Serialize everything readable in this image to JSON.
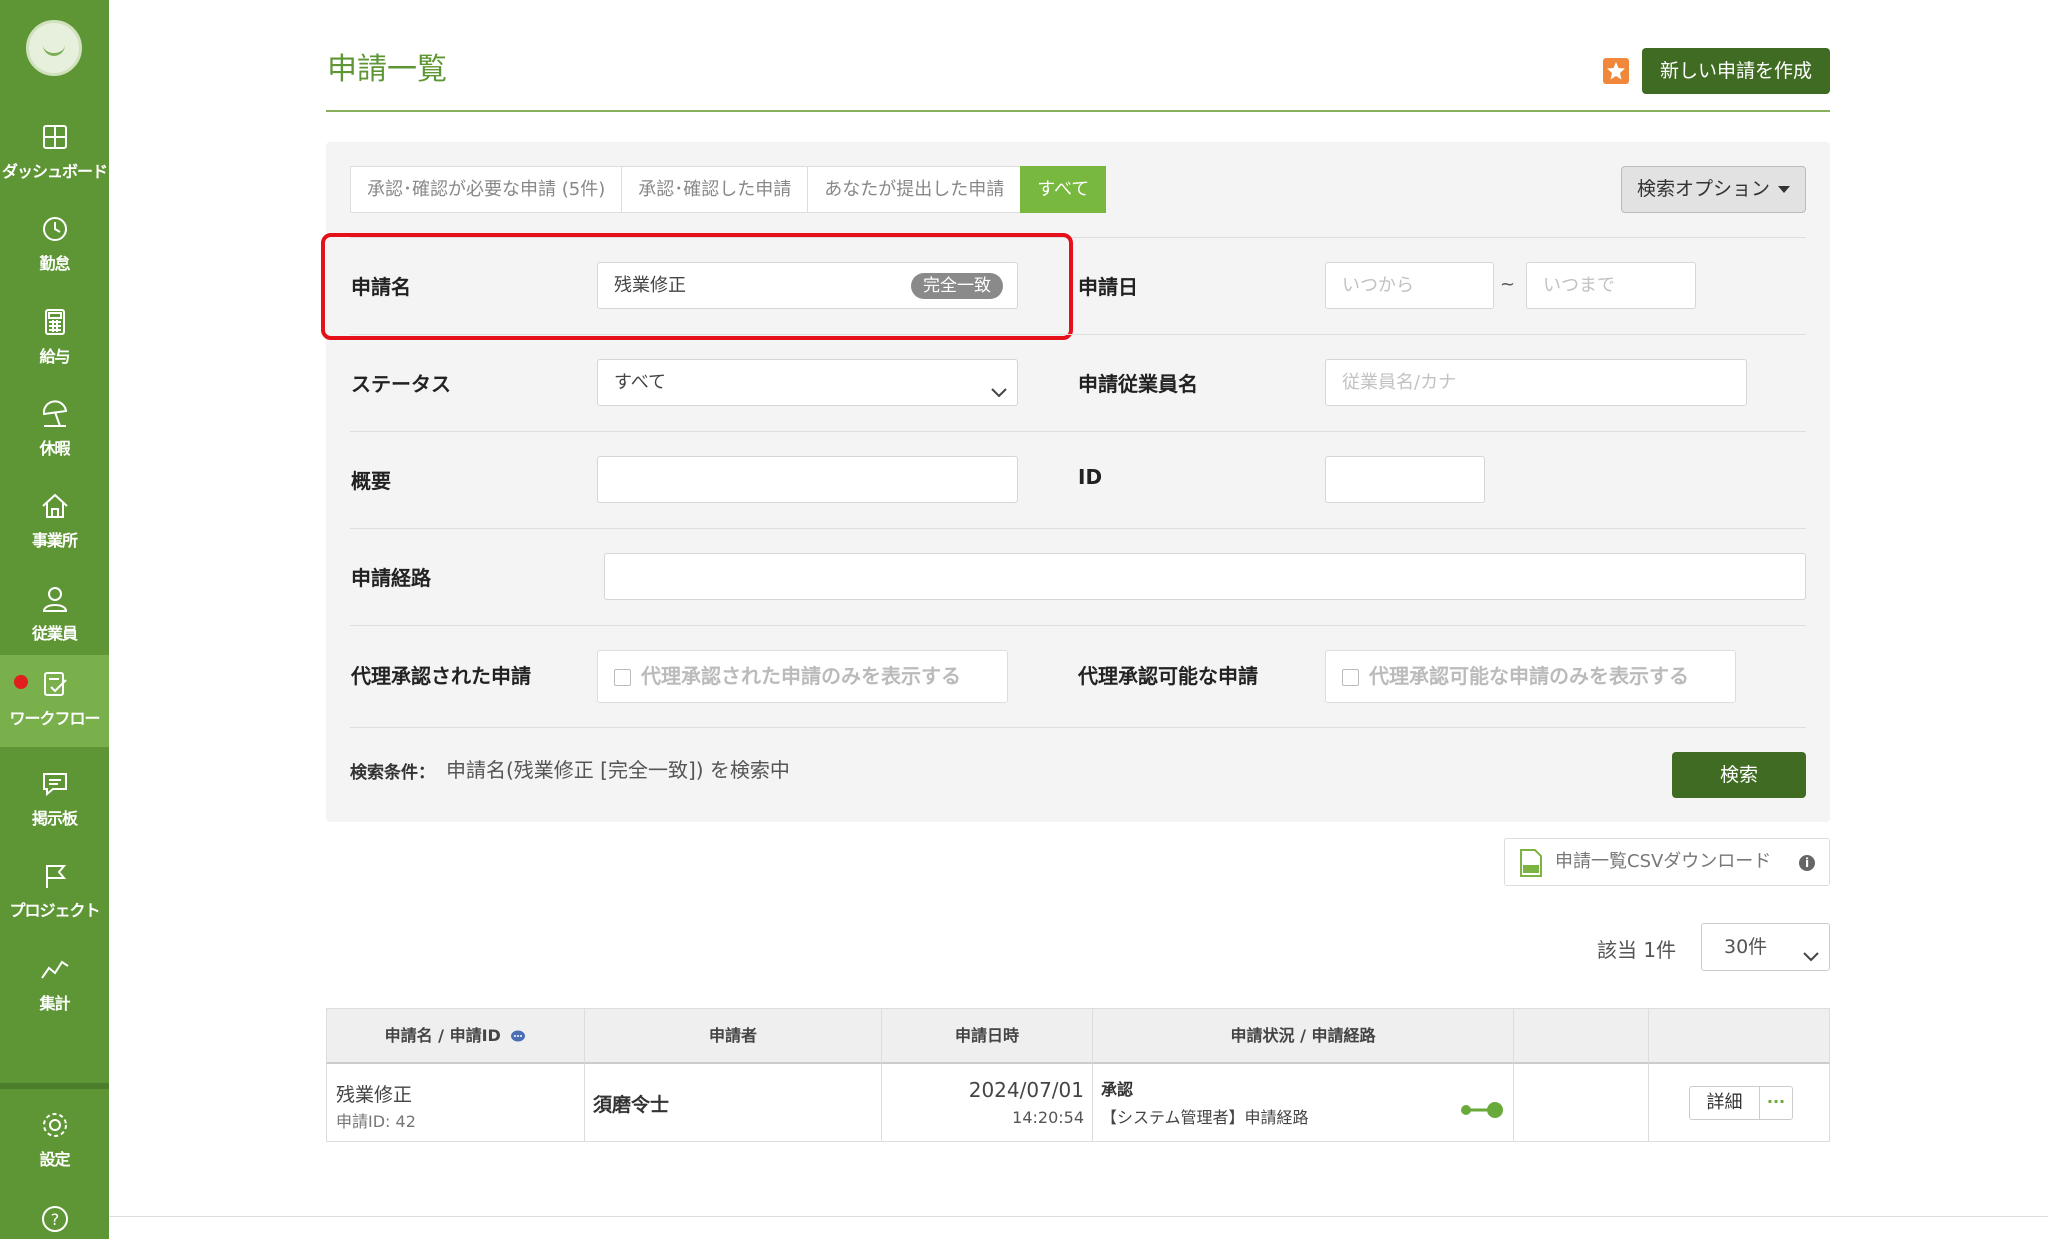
{
  "sidebar": {
    "items": [
      {
        "label": "ダッシュボード",
        "icon": "dashboard-icon"
      },
      {
        "label": "勤怠",
        "icon": "clock-icon"
      },
      {
        "label": "給与",
        "icon": "calculator-icon"
      },
      {
        "label": "休暇",
        "icon": "umbrella-icon"
      },
      {
        "label": "事業所",
        "icon": "home-icon"
      },
      {
        "label": "従業員",
        "icon": "user-icon"
      },
      {
        "label": "ワークフロー",
        "icon": "workflow-icon"
      },
      {
        "label": "掲示板",
        "icon": "message-icon"
      },
      {
        "label": "プロジェクト",
        "icon": "flag-icon"
      },
      {
        "label": "集計",
        "icon": "chart-line-icon"
      },
      {
        "label": "設定",
        "icon": "gear-icon"
      },
      {
        "label": "",
        "icon": "help-icon"
      }
    ],
    "help_glyph": "?"
  },
  "header": {
    "title": "申請一覧",
    "new_button": "新しい申請を作成"
  },
  "tabs": [
    "承認･確認が必要な申請 (5件)",
    "承認･確認した申請",
    "あなたが提出した申請",
    "すべて"
  ],
  "search_options_label": "検索オプション",
  "form": {
    "name_label": "申請名",
    "name_value": "残業修正",
    "name_match_badge": "完全一致",
    "date_label": "申請日",
    "date_from_placeholder": "いつから",
    "date_separator": "~",
    "date_to_placeholder": "いつまで",
    "status_label": "ステータス",
    "status_value": "すべて",
    "employee_label": "申請従業員名",
    "employee_placeholder": "従業員名/カナ",
    "summary_label": "概要",
    "id_label": "ID",
    "route_label": "申請経路",
    "proxy_approved_label": "代理承認された申請",
    "proxy_approved_checkbox": "代理承認された申請のみを表示する",
    "proxy_possible_label": "代理承認可能な申請",
    "proxy_possible_checkbox": "代理承認可能な申請のみを表示する",
    "condition_label": "検索条件：",
    "condition_value": "申請名(残業修正 [完全一致]) を検索中",
    "search_button": "検索"
  },
  "csv_button": "申請一覧CSVダウンロード",
  "result_count": "該当 1件",
  "per_page": "30件",
  "table": {
    "headers": [
      "申請名 / 申請ID",
      "申請者",
      "申請日時",
      "申請状況 / 申請経路",
      "",
      ""
    ],
    "rows": [
      {
        "name": "残業修正",
        "id": "申請ID: 42",
        "applicant": "須磨令士",
        "date": "2024/07/01",
        "time": "14:20:54",
        "status": "承認",
        "route": "【システム管理者】申請経路",
        "detail_button": "詳細",
        "more_button": "···"
      }
    ]
  },
  "colors": {
    "sidebar": "#5e9635",
    "accent": "#78b83e",
    "primary_button": "#3f6b22",
    "highlight": "#e5101a"
  }
}
